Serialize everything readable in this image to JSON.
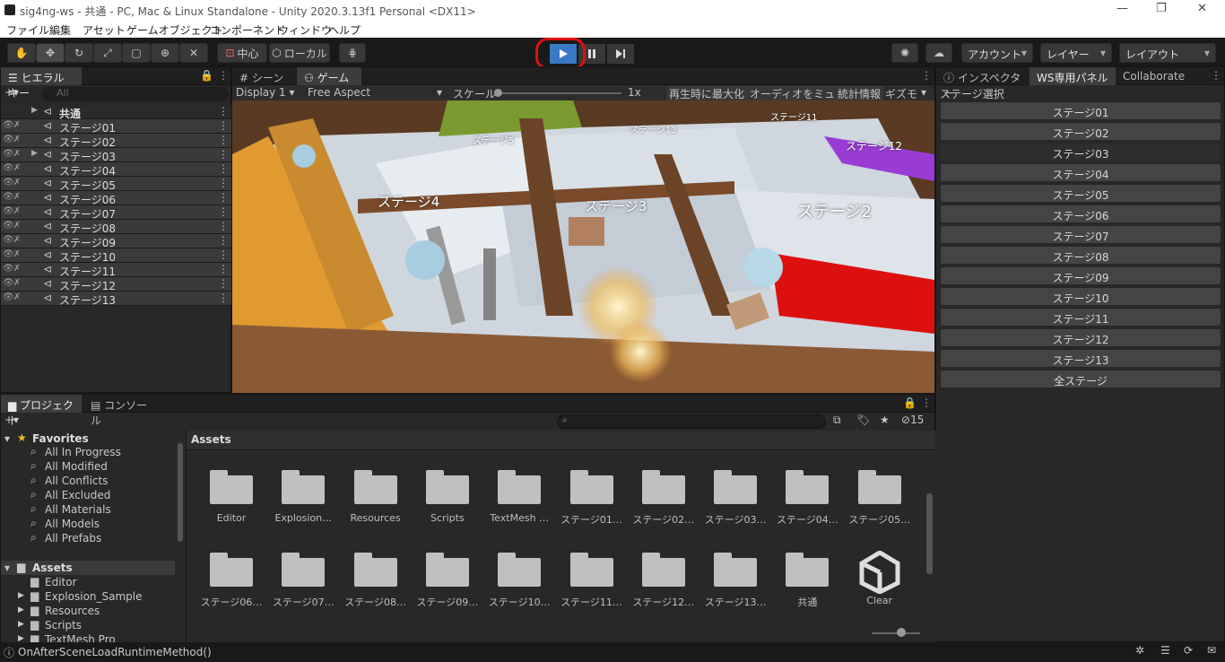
{
  "window": {
    "title": "sig4ng-ws - 共通 - PC, Mac & Linux Standalone - Unity 2020.3.13f1 Personal <DX11>",
    "minimize": "—",
    "maximize": "❐",
    "close": "✕"
  },
  "menu": [
    "ファイル",
    "編集",
    "アセット",
    "ゲームオブジェクト",
    "コンポーネント",
    "ウィンドウ",
    "ヘルプ"
  ],
  "toolbar": {
    "pivot_label": "中心",
    "space_label": "ローカル",
    "account_label": "アカウント",
    "layers_label": "レイヤー",
    "layout_label": "レイアウト"
  },
  "hierarchy": {
    "tab": "ヒエラルキー",
    "search_placeholder": "All",
    "items": [
      "共通",
      "ステージ01",
      "ステージ02",
      "ステージ03",
      "ステージ04",
      "ステージ05",
      "ステージ06",
      "ステージ07",
      "ステージ08",
      "ステージ09",
      "ステージ10",
      "ステージ11",
      "ステージ12",
      "ステージ13"
    ]
  },
  "center_tabs": {
    "scene": "シーン",
    "game": "ゲーム"
  },
  "game_toolbar": {
    "display": "Display 1",
    "aspect": "Free Aspect",
    "scale_label": "スケール",
    "scale_value": "1x",
    "maximize": "再生時に最大化",
    "mute": "オーディオをミュート",
    "stats": "統計情報",
    "gizmos": "ギズモ"
  },
  "game_labels": [
    "ステージ4",
    "ステージ3",
    "ステージ2",
    "ステージ5",
    "ステージ13",
    "ステージ11",
    "ステージ12"
  ],
  "inspector_tabs": [
    "インスペクター",
    "WS専用パネル",
    "Collaborate"
  ],
  "ws_panel": {
    "heading": "ステージ選択",
    "buttons": [
      "ステージ01",
      "ステージ02",
      "ステージ03",
      "ステージ04",
      "ステージ05",
      "ステージ06",
      "ステージ07",
      "ステージ08",
      "ステージ09",
      "ステージ10",
      "ステージ11",
      "ステージ12",
      "ステージ13",
      "全ステージ"
    ]
  },
  "project": {
    "tabs": [
      "プロジェクト",
      "コンソール"
    ],
    "hidden_count": "15",
    "favorites_label": "Favorites",
    "favorites": [
      "All In Progress",
      "All Modified",
      "All Conflicts",
      "All Excluded",
      "All Materials",
      "All Models",
      "All Prefabs"
    ],
    "assets_label": "Assets",
    "tree": [
      "Editor",
      "Explosion_Sample",
      "Resources",
      "Scripts",
      "TextMesh Pro"
    ],
    "breadcrumb": "Assets",
    "grid_row1": [
      "Editor",
      "Explosion…",
      "Resources",
      "Scripts",
      "TextMesh …",
      "ステージ01…",
      "ステージ02…",
      "ステージ03…",
      "ステージ04…",
      "ステージ05…"
    ],
    "grid_row2": [
      "ステージ06…",
      "ステージ07…",
      "ステージ08…",
      "ステージ09…",
      "ステージ10…",
      "ステージ11…",
      "ステージ12…",
      "ステージ13…",
      "共通",
      "Clear"
    ]
  },
  "status": {
    "message": "OnAfterSceneLoadRuntimeMethod()"
  },
  "colors": {
    "highlight_circle": "#e01010",
    "play_button": "#3a79c6",
    "panel_bg": "#282828"
  }
}
